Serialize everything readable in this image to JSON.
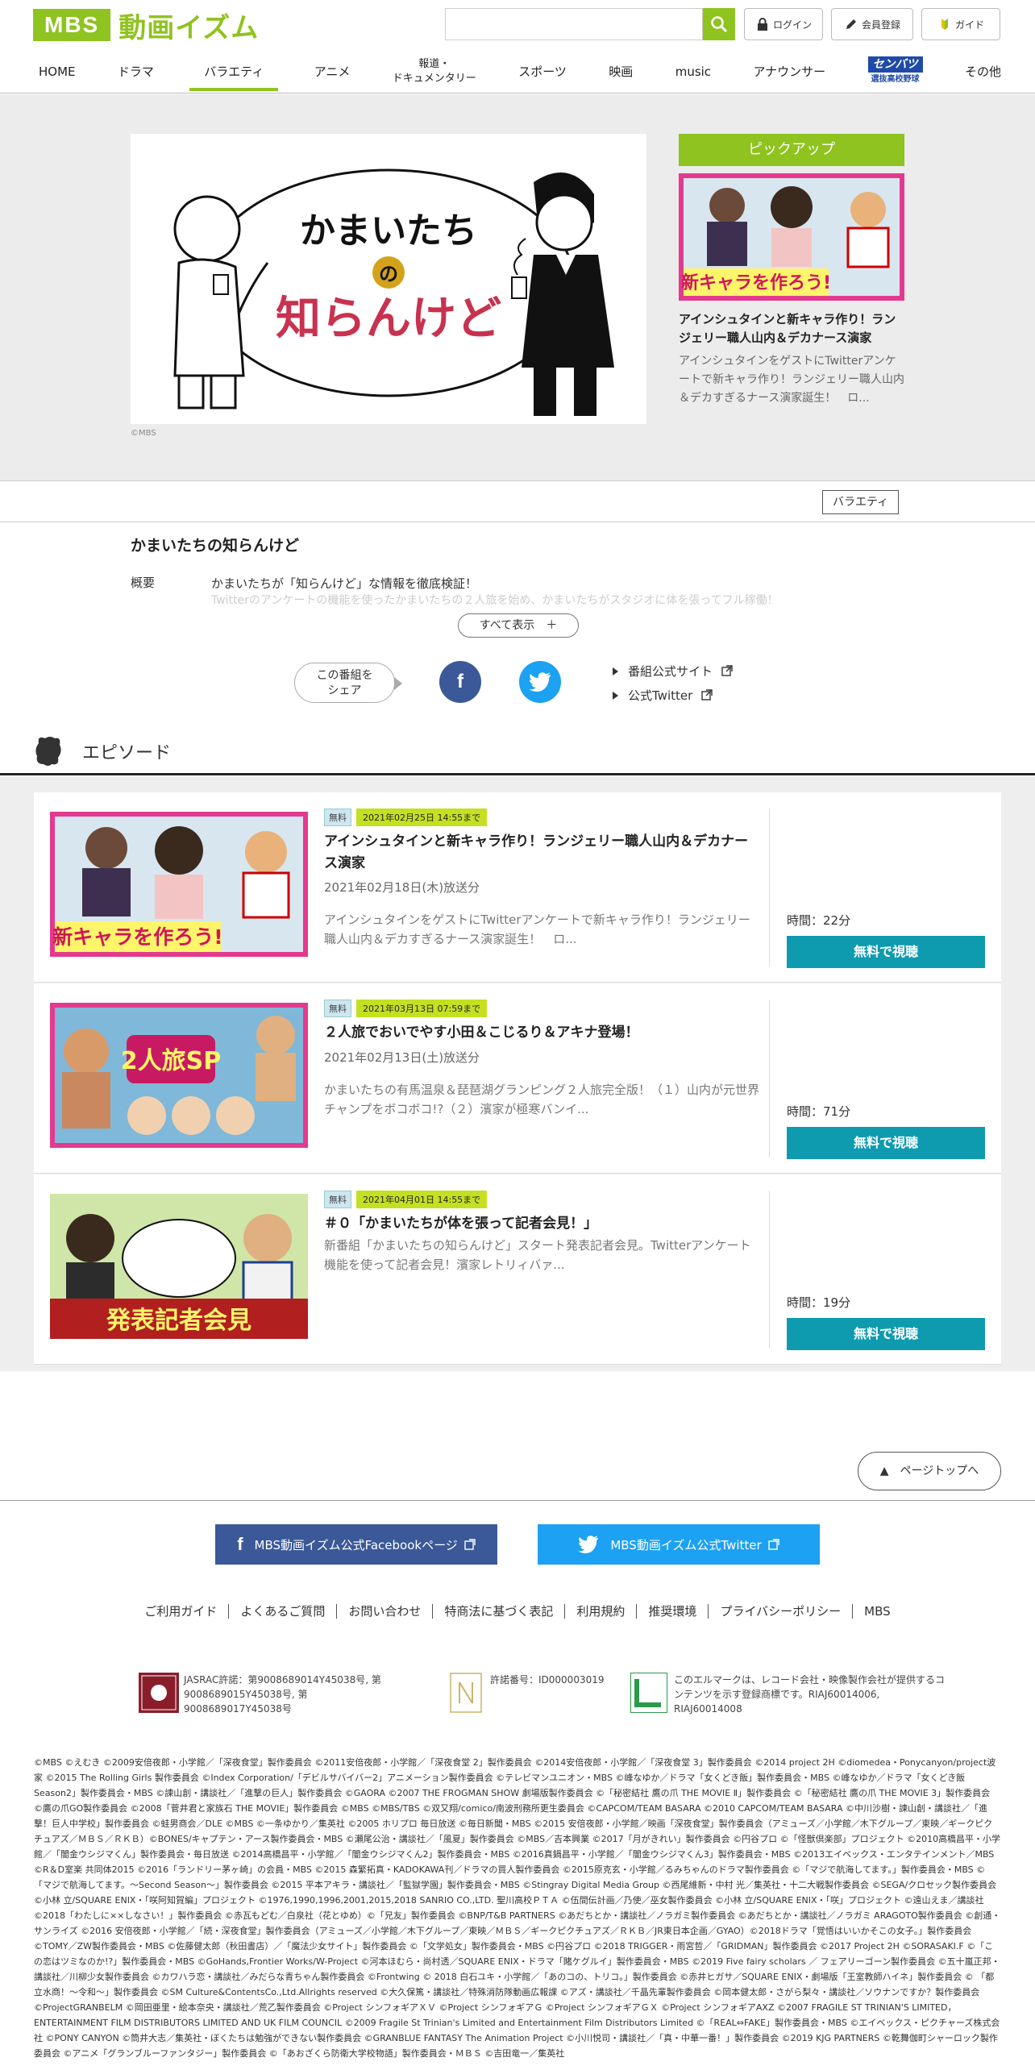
{
  "header": {
    "logo_mbs": "MBS",
    "logo_title": "動画イズム",
    "login": "ログイン",
    "register": "会員登録",
    "guide": "ガイド"
  },
  "nav": [
    {
      "label": "HOME"
    },
    {
      "label": "ドラマ"
    },
    {
      "label": "バラエティ"
    },
    {
      "label": "アニメ"
    },
    {
      "label": "報道・"
    },
    {
      "label": "ドキュメンタリー"
    },
    {
      "label": "スポーツ"
    },
    {
      "label": "映画"
    },
    {
      "label": "music"
    },
    {
      "label": "アナウンサー"
    },
    {
      "label": "センバツ"
    },
    {
      "label": "選抜高校野球"
    },
    {
      "label": "その他"
    }
  ],
  "hero": {
    "title_line1": "かまいたち",
    "title_no": "の",
    "title_line2": "知らんけど",
    "copyright": "©MBS"
  },
  "pickup": {
    "label": "ピックアップ",
    "title": "アインシュタインと新キャラ作り！ランジェリー職人山内＆デカナース演家",
    "desc": "アインシュタインをゲストにTwitterアンケートで新キャラ作り！ランジェリー職人山内＆デカすぎるナース演家誕生！　ロ...",
    "thumb_text": "新キャラを作ろう!"
  },
  "program": {
    "genre": "バラエティ",
    "title": "かまいたちの知らんけど",
    "gaiyo_label": "概要",
    "gaiyo_text": "かまいたちが「知らんけど」な情報を徹底検証！",
    "gaiyo_faded": "Twitterのアンケートの機能を使ったかまいたちの２人旅を始め、かまいたちがスタジオに体を張ってフル稼働！",
    "show_all": "すべて表示　＋",
    "share_line1": "この番組を",
    "share_line2": "シェア",
    "facebook_glyph": "f",
    "official_site": "番組公式サイト",
    "official_twitter": "公式Twitter"
  },
  "episodes_header": "エピソード",
  "episodes": [
    {
      "free": "無料",
      "until": "2021年02月25日 14:55まで",
      "title": "アインシュタインと新キャラ作り！ランジェリー職人山内＆デカナース演家",
      "air": "2021年02月18日(木)放送分",
      "desc": "アインシュタインをゲストにTwitterアンケートで新キャラ作り！ランジェリー職人山内＆デカすぎるナース演家誕生！　ロ...",
      "time": "時間：22分",
      "watch": "無料で視聴",
      "thumb_text": "新キャラを作ろう!"
    },
    {
      "free": "無料",
      "until": "2021年03月13日 07:59まで",
      "title": "２人旅でおいでやす小田＆こじるり＆アキナ登場！",
      "air": "2021年02月13日(土)放送分",
      "desc": "かまいたちの有馬温泉＆琵琶湖グランピング２人旅完全版！（１）山内が元世界チャンプをボコボコ!?（２）濱家が極寒バンイ...",
      "time": "時間：71分",
      "watch": "無料で視聴",
      "thumb_text": "2人旅SP"
    },
    {
      "free": "無料",
      "until": "2021年04月01日 14:55まで",
      "title": "＃０「かまいたちが体を張って記者会見！」",
      "air": "",
      "desc": "新番組「かまいたちの知らんけど」スタート発表記者会見。Twitterアンケート機能を使って記者会見！濱家レトリィバァ...",
      "time": "時間：19分",
      "watch": "無料で視聴",
      "thumb_text": "発表記者会見"
    }
  ],
  "footer": {
    "pagetop": "▲　ページトップへ",
    "facebook_banner": "MBS動画イズム公式Facebookページ",
    "twitter_banner": "MBS動画イズム公式Twitter",
    "links": [
      "ご利用ガイド",
      "よくあるご質問",
      "お問い合わせ",
      "特商法に基づく表記",
      "利用規約",
      "推奨環境",
      "プライバシーポリシー",
      "MBS"
    ],
    "jasrac": "JASRAC許諾：第9008689014Y45038号, 第9008689015Y45038号, 第9008689017Y45038号",
    "nextone": "許諾番号：ID000003019",
    "lmark": "このエルマークは、レコード会社・映像製作会社が提供するコンテンツを示す登録商標です。RIAJ60014006, RIAJ60014008",
    "copyright": "©MBS ©えむき ©2009安倍夜郎・小学館／「深夜食堂」製作委員会 ©2011安倍夜郎・小学館／「深夜食堂 2」製作委員会 ©2014安倍夜郎・小学館／「深夜食堂 3」製作委員会 ©2014 project 2H ©diomedea・Ponycanyon/project波家 ©2015 The Rolling Girls 製作委員会 ©Index Corporation/「デビルサバイバー2」アニメーション製作委員会 ©テレビマンユニオン・MBS ©峰なゆか／ドラマ「女くどき飯」製作委員会・MBS ©峰なゆか／ドラマ「女くどき飯 Season2」製作委員会・MBS ©諫山創・講談社／「進撃の巨人」製作委員会 ©GAORA ©2007 THE FROGMAN SHOW 劇場版製作委員会 ©「秘密結社 鷹の爪 THE MOVIE Ⅱ」製作委員会 ©「秘密結社 鷹の爪 THE MOVIE 3」製作委員会 ©鷹の爪GO製作委員会 ©2008「菅井君と家族石 THE MOVIE」製作委員会 ©MBS ©MBS/TBS ©双又翔/comico/南波刑務所更生委員会 ©CAPCOM/TEAM BASARA ©2010 CAPCOM/TEAM BASARA ©中川沙樹・諫山創・講談社／「進撃！巨人中学校」製作委員会 ©蛙男商会／DLE ©MBS ©一条ゆかり／集英社 ©2005 ホリプロ 毎日放送 ©毎日新聞・MBS ©2015 安倍夜郎・小学館／映画「深夜食堂」製作委員会（アミューズ／小学館／木下グループ／東映／ギークピクチュアズ／ＭＢＳ／ＲＫＢ）©BONES/キャプテン・アース製作委員会・MBS ©瀬尾公治・講談社／「風夏」製作委員会 ©MBS／吉本興業 ©2017「月がきれい」製作委員会 ©円谷プロ ©「怪獣倶楽部」プロジェクト ©2010高橋昌平・小学館／「闇金ウシジマくん」製作委員会・毎日放送 ©2014高橋昌平・小学館／「闇金ウシジマくん2」製作委員会・MBS ©2016真鍋昌平・小学館／「闇金ウシジマくん3」製作委員会・MBS ©2013エイベックス・エンタテインメント／MBS ©R＆D室楽 共同体2015 ©2016「ランドリー茅ヶ崎」の会員・MBS ©2015 森繁拓真・KADOKAWA刊／ドラマの買人製作委員会 ©2015原克玄・小学館／るみちゃんのドラマ製作委員会 ©「マジで航海してます。」製作委員会・MBS ©「マジで航海してます。～Second Season～」製作委員会 ©2015 平本アキラ・講談社／「監獄学園」製作委員会・MBS ©Stingray Digital Media Group ©西尾維新・中村 光／集英社・十二大戦製作委員会 ©SEGA/クロセック製作委員会 ©小林 立/SQUARE ENIX・「咲阿知賀編」プロジェクト ©1976,1990,1996,2001,2015,2018 SANRIO CO.,LTD. 聖川高校ＰＴＡ ©伍間伝計画／乃使／巫女製作委員会 ©小林 立/SQUARE ENIX・「咲」プロジェクト ©遠山えま／講談社 ©2018「わたしに××しなさい！」製作委員会 ©赤瓦もどむ／白泉社（花とゆめ）©「兄友」製作委員会 ©BNP/T&B PARTNERS ©あだちとか・講談社／ノラガミ製作委員会 ©あだちとか・講談社／ノラガミ ARAGOTO製作委員会 ©創通・サンライズ ©2016 安倍夜郎・小学館／「続・深夜食堂」製作委員会（アミューズ／小学館／木下グループ／東映／ＭＢＳ／ギークピクチュアズ／ＲＫＢ／JR東日本企画／GYAO）©2018ドラマ「覚悟はいいかそこの女子。」製作委員会 ©TOMY／ZW製作委員会・MBS ©佐藤健太郎（秋田書店）／「魔法少女サイト」製作委員会 ©「文学処女」製作委員会・MBS ©円谷プロ ©2018 TRIGGER・雨宮哲／「GRIDMAN」製作委員会 ©2017 Project 2H ©SORASAKI.F ©「この恋はツミなのか!?」製作委員会・MBS ©GoHands,Frontier Works/W-Project ©河本ほむら・尚村透／SQUARE ENIX・ドラマ「賭ケグルイ」製作委員会・MBS ©2019 Five fairy scholars ／ フェアリーゴーン製作委員会 ©五十嵐正邦・講談社／川柳少女製作委員会 ©カワハラ恋・講談社／みだらな青ちゃん製作委員会 ©Frontwing © 2018 白石ユキ・小学館／「あのコの、トリコ。」製作委員会 ©赤井ヒガサ／SQUARE ENIX・劇場版「王室教師ハイネ」製作委員会 © 「都立水商！～令和～」製作委員会 ©SM Culture&ContentsCo.,Ltd.Allrights reserved ©大久保篤・講談社／特殊消防隊動画広報課 ©アズ・講談社／千晶先輩製作委員会 ©岡本健太郎・さがら梨々・講談社／ソウナンですか？製作委員会 ©ProjectGRANBELM ©岡田亜里・絵本奈央・講談社／荒乙製作委員会 ©Project シンフォギアＸＶ ©Project シンフォギアＧ ©Project シンフォギアＧＸ ©Project シンフォギアAXZ ©2007 FRAGILE ST TRINIAN'S LIMITED，ENTERTAINMENT FILM DISTRIBUTORS LIMITED AND UK FILM COUNCIL ©2009 Fragile St Trinian's Limited and Entertainment Film Distributors Limited ©「REAL⇔FAKE」製作委員会・MBS ©エイベックス・ピクチャーズ株式会社 ©PONY CANYON ©筒井大志／集英社・ぼくたちは勉強ができない製作委員会 ©GRANBLUE FANTASY The Animation Project ©小川悦司・講談社／「真・中華一番！」製作委員会 ©2019 KJG PARTNERS ©乾舞伽町シャーロック製作委員会 ©アニメ「グランブルーファンタジー」製作委員会 ©「あおざくら防衛大学校物語」製作委員会・ＭＢＳ ©吉田竜一／集英社"
  }
}
